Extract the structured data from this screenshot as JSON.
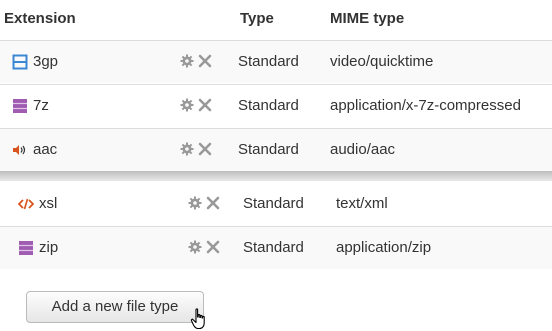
{
  "table": {
    "headers": {
      "extension": "Extension",
      "type": "Type",
      "mime": "MIME type"
    },
    "rows": [
      {
        "extension": "3gp",
        "icon": "video-icon",
        "type": "Standard",
        "mime": "video/quicktime"
      },
      {
        "extension": "7z",
        "icon": "archive-icon",
        "type": "Standard",
        "mime": "application/x-7z-compressed"
      },
      {
        "extension": "aac",
        "icon": "audio-icon",
        "type": "Standard",
        "mime": "audio/aac"
      },
      {
        "extension": "xsl",
        "icon": "code-icon",
        "type": "Standard",
        "mime": "text/xml"
      },
      {
        "extension": "zip",
        "icon": "archive-icon",
        "type": "Standard",
        "mime": "application/zip"
      }
    ]
  },
  "actions": {
    "add_label": "Add a new file type"
  },
  "colors": {
    "video": "#3a87d6",
    "archive": "#a05cb0",
    "audio": "#d9531e",
    "code": "#d9531e",
    "action_icon": "#999999"
  }
}
